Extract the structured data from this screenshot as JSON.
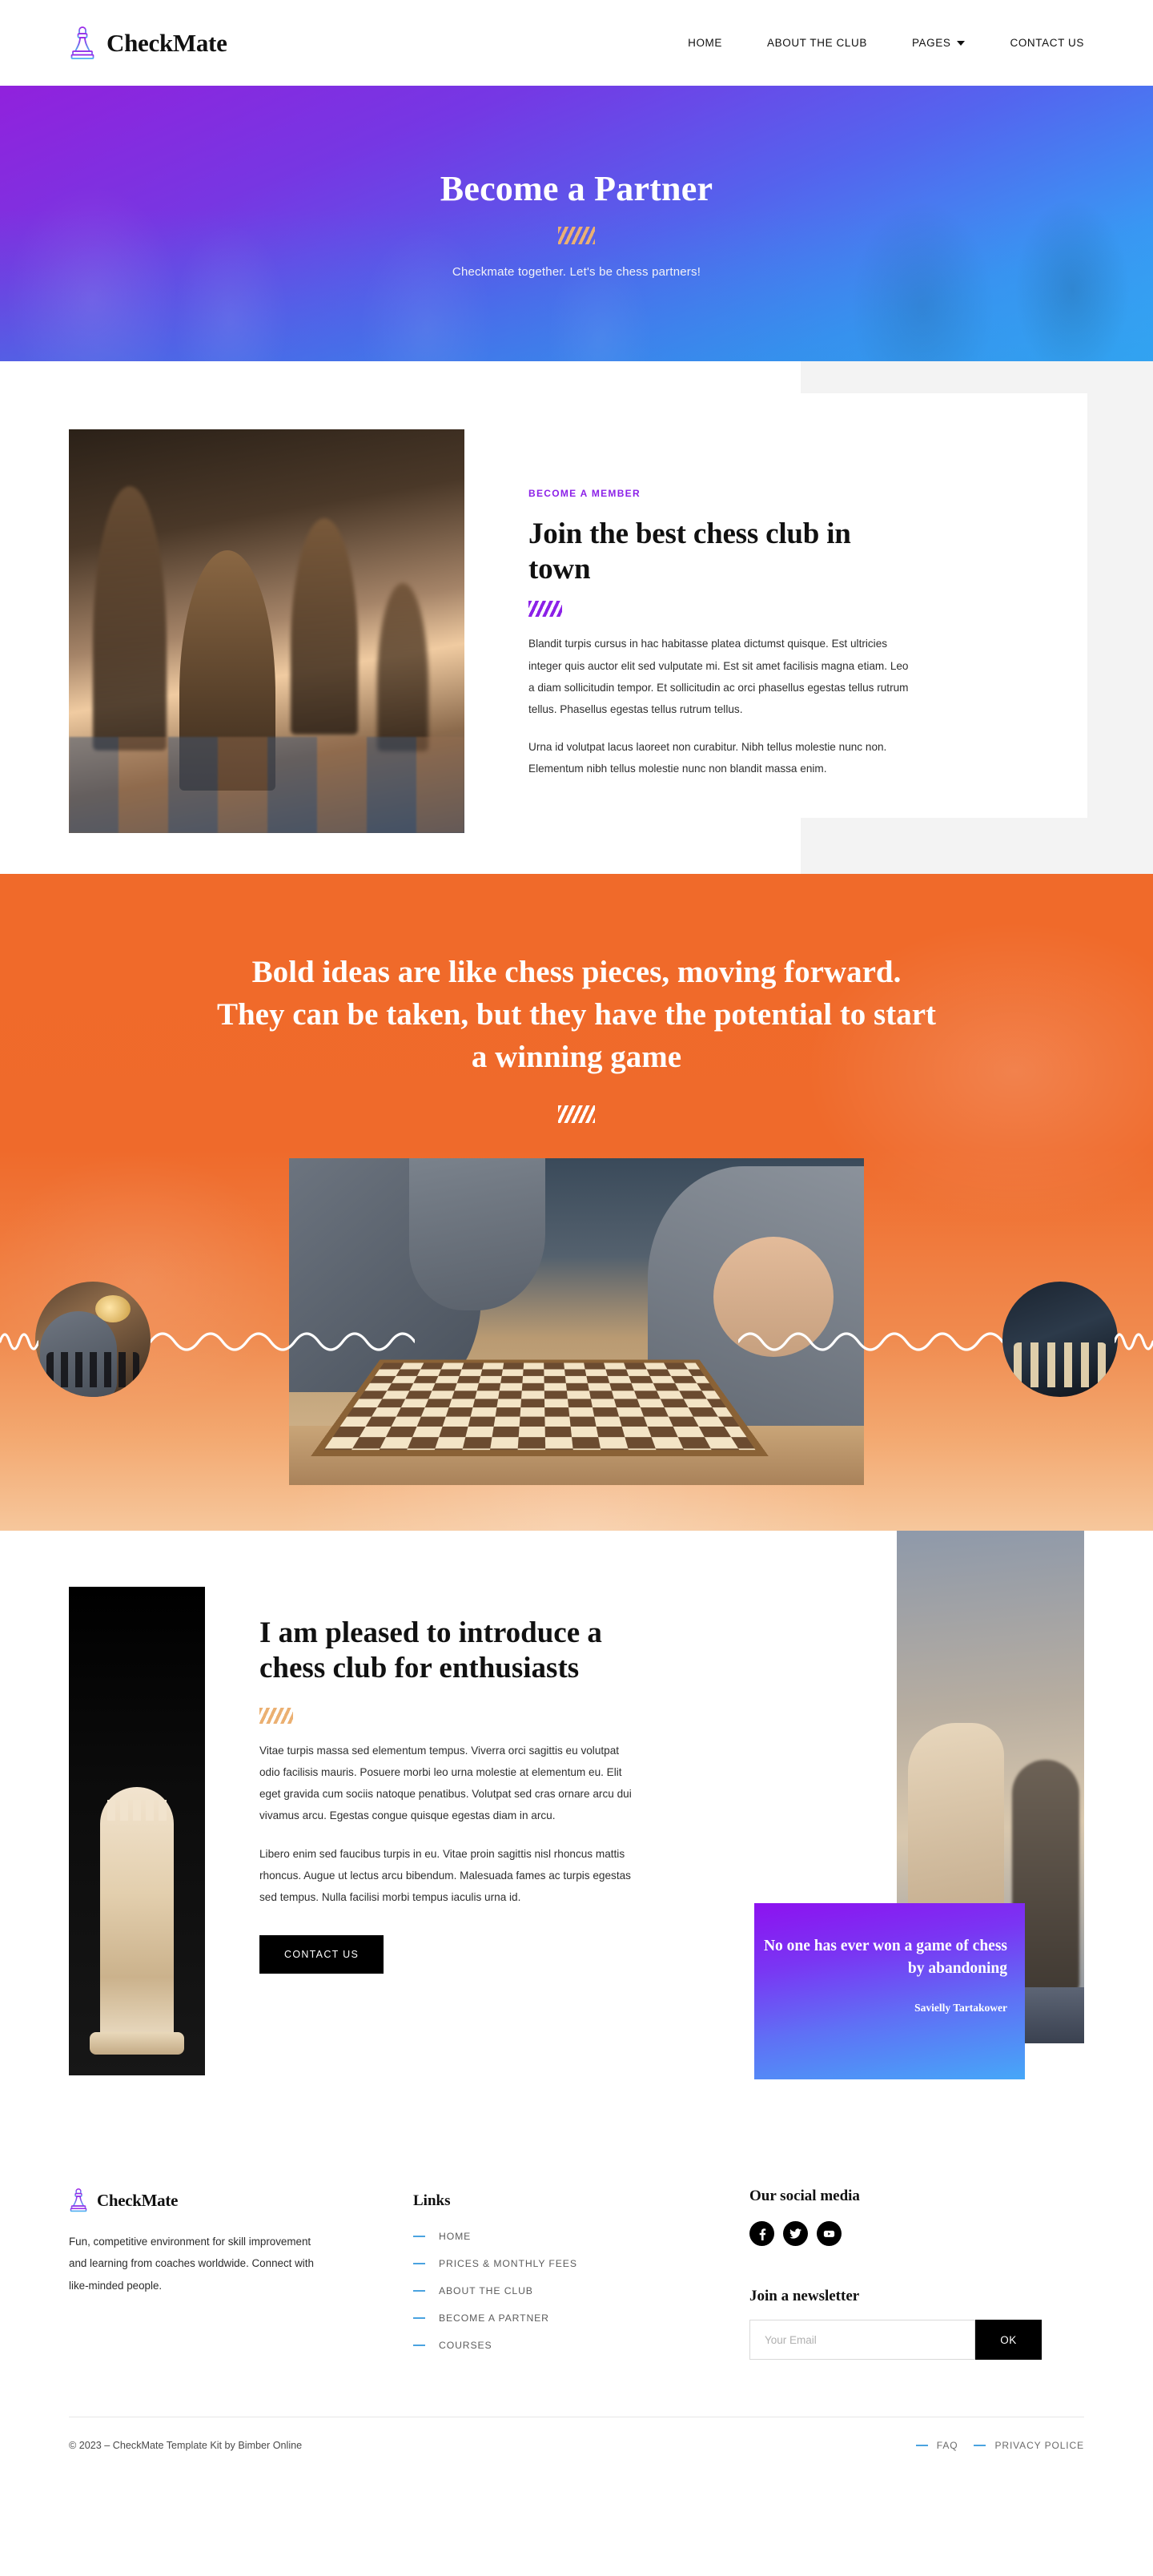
{
  "header": {
    "brand": "CheckMate",
    "logo_icon": "chess-pawn-icon",
    "nav": [
      {
        "label": "HOME",
        "has_caret": false
      },
      {
        "label": "ABOUT THE CLUB",
        "has_caret": false
      },
      {
        "label": "PAGES",
        "has_caret": true
      },
      {
        "label": "CONTACT US",
        "has_caret": false
      }
    ]
  },
  "hero": {
    "title": "Become a Partner",
    "subtitle": "Checkmate together. Let's be chess partners!",
    "divider_icon": "hatch-divider-icon",
    "gradient_from": "#961be5",
    "gradient_to": "#38b2fa"
  },
  "member": {
    "eyebrow": "BECOME A MEMBER",
    "heading": "Join the best chess club in town",
    "divider_icon": "hatch-divider-icon",
    "accent": "#8c21e8",
    "paragraph1": "Blandit turpis cursus in hac habitasse platea dictumst quisque. Est ultricies integer quis auctor elit sed vulputate mi. Est sit amet facilisis magna etiam. Leo a diam sollicitudin tempor. Et sollicitudin ac orci phasellus egestas tellus rutrum tellus. Phasellus egestas tellus rutrum tellus.",
    "paragraph2": "Urna id volutpat lacus laoreet non curabitur. Nibh tellus molestie nunc non. Elementum nibh tellus molestie nunc non blandit massa enim.",
    "photo_alt": "chess-knight-photo"
  },
  "quote_banner": {
    "heading": "Bold ideas are like chess pieces, moving forward. They can be taken, but they have the potential to start a winning game",
    "divider_icon": "hatch-divider-icon",
    "background": "#f06a2a",
    "center_photo_alt": "two-players-chess-photo",
    "left_circle_alt": "bearded-player-circle-photo",
    "right_circle_alt": "chess-pieces-circle-photo"
  },
  "intro": {
    "heading": "I am pleased to introduce a chess club for enthusiasts",
    "divider_icon": "hatch-divider-icon",
    "paragraph1": "Vitae turpis massa sed elementum tempus. Viverra orci sagittis eu volutpat odio facilisis mauris. Posuere morbi leo urna molestie at elementum eu. Elit eget gravida cum sociis natoque penatibus. Volutpat sed cras ornare arcu dui vivamus arcu. Egestas congue quisque egestas diam in arcu.",
    "paragraph2": "Libero enim sed faucibus turpis in eu. Vitae proin sagittis nisl rhoncus mattis rhoncus. Augue ut lectus arcu bibendum. Malesuada fames ac turpis egestas sed tempus. Nulla facilisi morbi tempus iaculis urna id.",
    "button_label": "CONTACT US",
    "left_photo_alt": "white-queen-photo",
    "right_photo_alt": "knight-sunset-photo",
    "quote_card": {
      "text": "No one has ever won a game of chess by abandoning",
      "author": "Savielly Tartakower",
      "gradient_from": "#8d12f0",
      "gradient_to": "#46a7f8"
    }
  },
  "footer": {
    "brand": "CheckMate",
    "logo_icon": "chess-pawn-icon",
    "about": "Fun, competitive environment for skill improvement and learning from coaches worldwide. Connect with like-minded people.",
    "links_heading": "Links",
    "links": [
      "HOME",
      "PRICES & MONTHLY FEES",
      "ABOUT THE CLUB",
      "BECOME A PARTNER",
      "COURSES"
    ],
    "social_heading": "Our social media",
    "socials": [
      {
        "name": "facebook-icon",
        "glyph": "f"
      },
      {
        "name": "twitter-icon",
        "glyph": "t"
      },
      {
        "name": "youtube-icon",
        "glyph": "y"
      }
    ],
    "newsletter_heading": "Join a newsletter",
    "newsletter_placeholder": "Your Email",
    "newsletter_value": "",
    "newsletter_button": "OK",
    "copyright": "© 2023 – CheckMate Template Kit by Bimber Online",
    "bottom_links": [
      "FAQ",
      "PRIVACY POLICE"
    ],
    "dash_color": "#4aa3e0"
  }
}
